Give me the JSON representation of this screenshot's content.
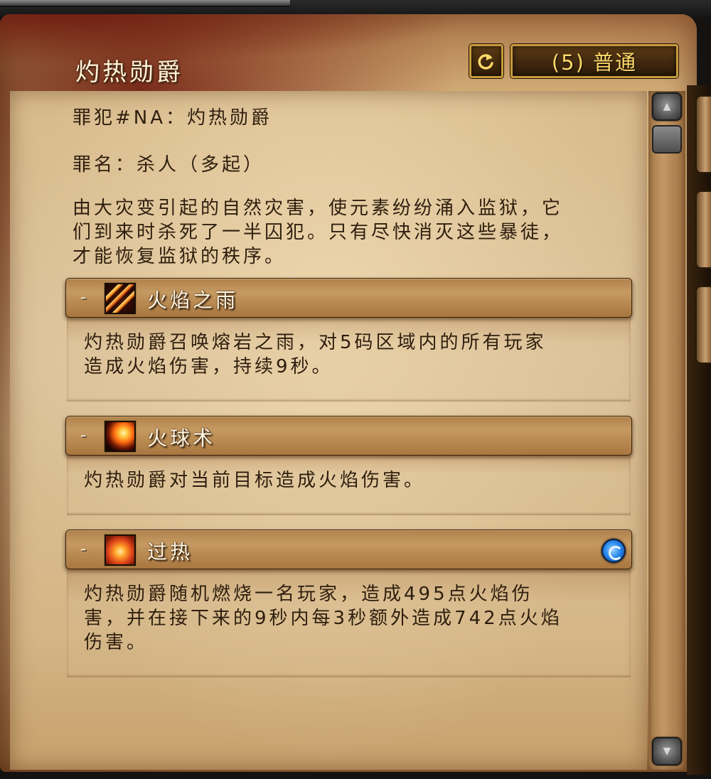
{
  "window": {
    "title": "灼热勋爵",
    "difficulty_label": "(5) 普通"
  },
  "intro": {
    "prisoner_line": "罪犯#NA：灼热勋爵",
    "crime_line": "罪名：杀人（多起）",
    "description_lines": [
      "由大灾变引起的自然灾害，使元素纷纷涌入监狱，它",
      "们到来时杀死了一半囚犯。只有尽快消灭这些暴徒，",
      "才能恢复监狱的秩序。"
    ]
  },
  "abilities": [
    {
      "collapse_symbol": "-",
      "icon": "rain-of-fire-icon",
      "name": "火焰之雨",
      "description_lines": [
        "灼热勋爵召唤熔岩之雨，对5码区域内的所有玩家",
        "造成火焰伤害，持续9秒。"
      ]
    },
    {
      "collapse_symbol": "-",
      "icon": "fireball-icon",
      "name": "火球术",
      "description_lines": [
        "灼热勋爵对当前目标造成火焰伤害。"
      ]
    },
    {
      "collapse_symbol": "-",
      "icon": "overheat-icon",
      "name": "过热",
      "flag_icon": "magic-dispel-icon",
      "description_lines": [
        "灼热勋爵随机燃烧一名玩家，造成495点火焰伤",
        "害，并在接下来的9秒内每3秒额外造成742点火焰",
        "伤害。"
      ]
    }
  ],
  "scrollbar": {
    "up_icon": "scroll-up-icon",
    "down_icon": "scroll-down-icon"
  },
  "colors": {
    "title_text": "#fff2d6",
    "difficulty_text": "#ffd96a",
    "body_text": "#2e1e0e",
    "button_border": "#c99a3a",
    "dispel_blue": "#2a8cf0"
  }
}
